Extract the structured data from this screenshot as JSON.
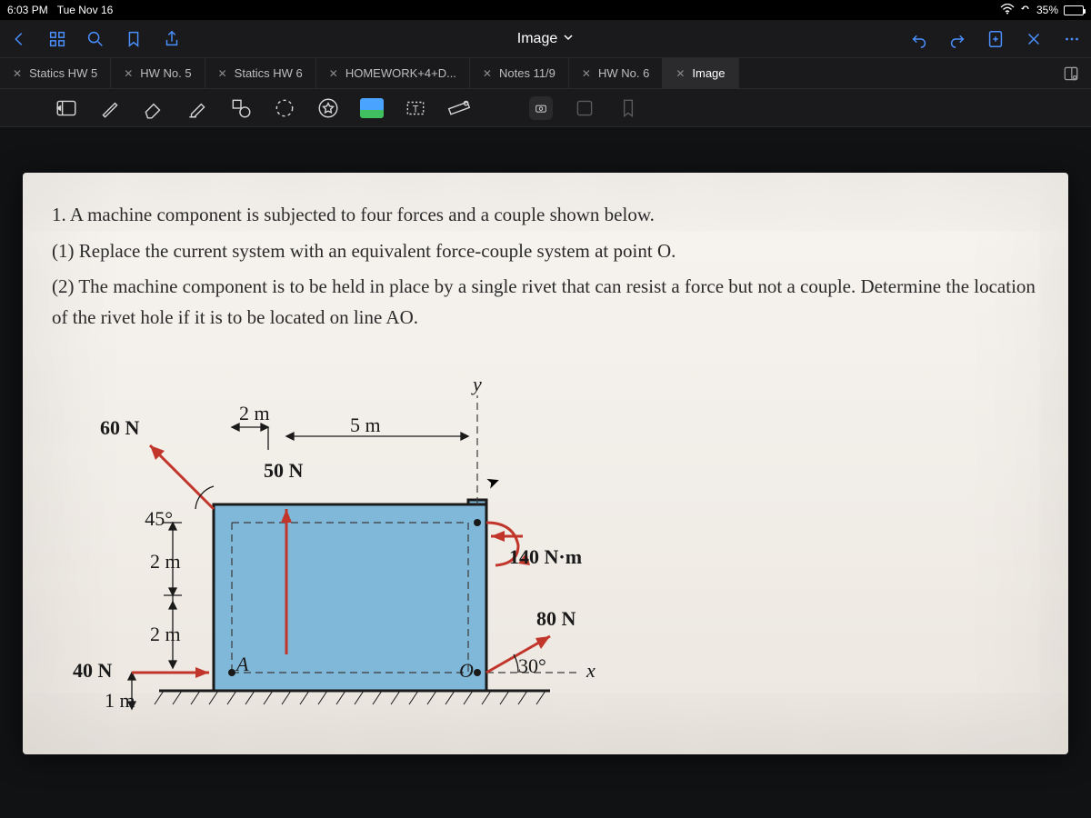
{
  "status": {
    "time": "6:03 PM",
    "date": "Tue Nov 16",
    "battery_pct": "35%"
  },
  "nav": {
    "title": "Image"
  },
  "tabs": [
    {
      "label": "Statics HW 5"
    },
    {
      "label": "HW No. 5"
    },
    {
      "label": "Statics HW 6"
    },
    {
      "label": "HOMEWORK+4+D..."
    },
    {
      "label": "Notes 11/9"
    },
    {
      "label": "HW No. 6"
    },
    {
      "label": "Image"
    }
  ],
  "problem": {
    "line1": "1. A machine component is subjected to four forces and a couple shown below.",
    "line2": "(1) Replace the current system with an equivalent force-couple system at point O.",
    "line3": "(2) The machine component is to be held in place by a single rivet that can resist a force but not a couple. Determine the location of the rivet hole if it is to be located on line AO."
  },
  "diagram": {
    "y_axis": "y",
    "x_axis": "x",
    "dim_2m_top": "2 m",
    "dim_5m": "5 m",
    "dim_2m_left_upper": "2 m",
    "dim_2m_left_lower": "2 m",
    "dim_1m": "1 m",
    "force_60N": "60 N",
    "angle_45": "45°",
    "force_50N": "50 N",
    "moment_140": "140 N·m",
    "force_80N": "80 N",
    "angle_30": "30°",
    "force_40N": "40 N",
    "point_A": "A",
    "point_O": "O"
  }
}
